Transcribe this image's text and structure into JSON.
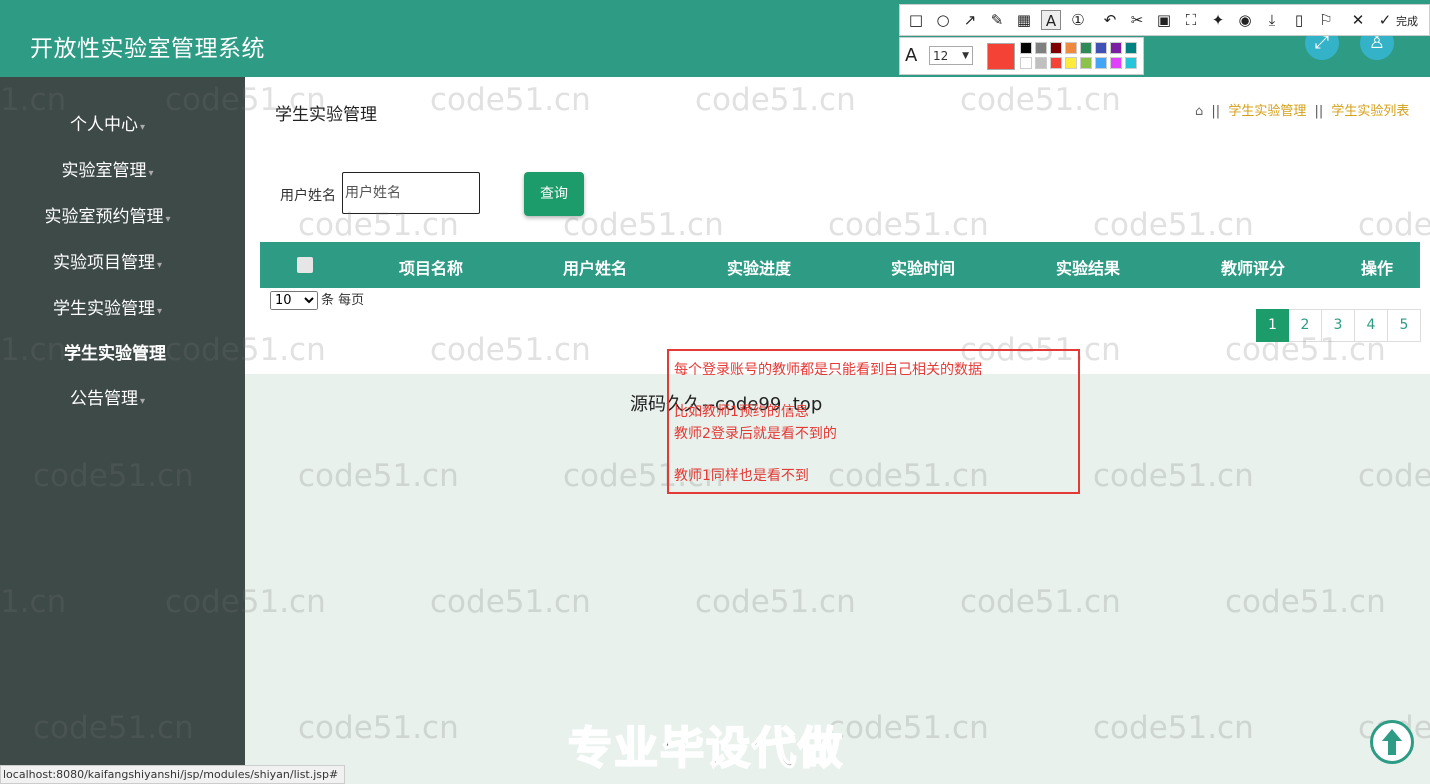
{
  "app": {
    "title": "开放性实验室管理系统"
  },
  "header_icons": [
    {
      "name": "fullscreen-icon"
    },
    {
      "name": "user-icon"
    }
  ],
  "sidebar": {
    "items": [
      {
        "label": "个人中心",
        "active": false
      },
      {
        "label": "实验室管理",
        "active": false
      },
      {
        "label": "实验室预约管理",
        "active": false
      },
      {
        "label": "实验项目管理",
        "active": false
      },
      {
        "label": "学生实验管理",
        "active": false
      },
      {
        "label": "学生实验管理",
        "active": true
      },
      {
        "label": "公告管理",
        "active": false
      }
    ]
  },
  "page": {
    "heading": "学生实验管理",
    "breadcrumb": {
      "sep": "||",
      "level1": "学生实验管理",
      "level2": "学生实验列表"
    }
  },
  "search": {
    "label": "用户姓名",
    "placeholder": "用户姓名",
    "value": "",
    "button": "查询"
  },
  "table": {
    "columns": [
      "项目名称",
      "用户姓名",
      "实验进度",
      "实验时间",
      "实验结果",
      "教师评分",
      "操作"
    ],
    "rows": []
  },
  "page_size": {
    "selected": "10",
    "suffix": "条 每页"
  },
  "pagination": {
    "pages": [
      "1",
      "2",
      "3",
      "4",
      "5"
    ],
    "active": "1"
  },
  "annotation": {
    "lines": [
      "每个登录账号的教师都是只能看到自己相关的数据",
      "比如教师1预约的信息",
      "教师2登录后就是看不到的",
      "教师1同样也是看不到"
    ],
    "color": "#e53935"
  },
  "overlay_text": {
    "source": "源码久久--code99 .top",
    "promo": "专业毕设代做",
    "watermark": "code51.cn"
  },
  "status_bar": {
    "url": "localhost:8080/kaifangshiyanshi/jsp/modules/shiyan/list.jsp#"
  },
  "screenshot_toolbar": {
    "tools": [
      "rectangle-icon",
      "ellipse-icon",
      "arrow-icon",
      "pen-icon",
      "mosaic-icon",
      "text-icon",
      "number-icon",
      "undo-icon",
      "ocr-icon",
      "pin-icon",
      "long-capture-icon",
      "record-icon",
      "download-icon",
      "save-icon",
      "bookmark-icon",
      "close-icon"
    ],
    "done_label": "完成",
    "font_size": "12",
    "current_color": "#f44336",
    "palette": [
      "#000000",
      "#808080",
      "#800000",
      "#f0883e",
      "#2e8b57",
      "#3f51b5",
      "#7b1fa2",
      "#008080",
      "#ffffff",
      "#c0c0c0",
      "#f44336",
      "#ffeb3b",
      "#8bc34a",
      "#42a5f5",
      "#e040fb",
      "#26c6da"
    ]
  },
  "colors": {
    "header": "#2e9b85",
    "sidebar": "#3d4a48",
    "accent": "#1c9c6a",
    "breadcrumb": "#d4a017"
  }
}
